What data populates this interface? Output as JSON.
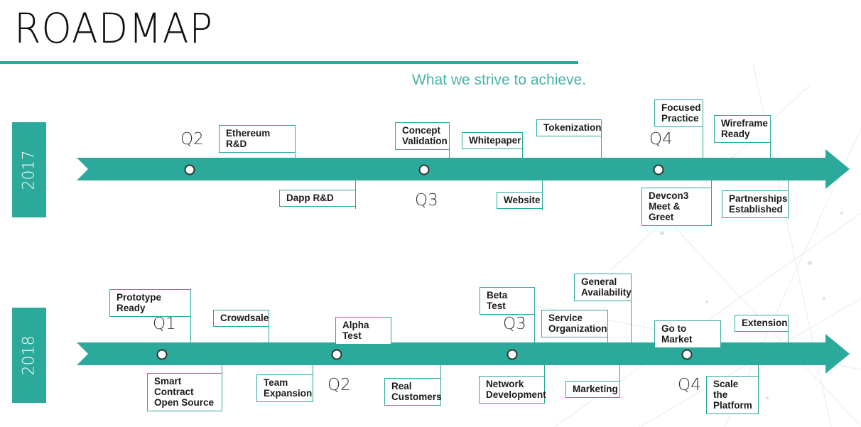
{
  "header": {
    "title": "ROADMAP",
    "subtitle": "What we strive to achieve."
  },
  "colors": {
    "accent": "#2ba99a",
    "subtitle": "#48b3a8",
    "text": "#1a1a1a"
  },
  "timelines": [
    {
      "year": "2017",
      "quarters": [
        "Q2",
        "Q3",
        "Q4"
      ],
      "milestones": {
        "ethereum_rd": "Ethereum R&D",
        "dapp_rd": "Dapp R&D",
        "concept_validation": "Concept\nValidation",
        "whitepaper": "Whitepaper",
        "website": "Website",
        "tokenization": "Tokenization",
        "focused_practice": "Focused\nPractice",
        "wireframe_ready": "Wireframe\nReady",
        "devcon3": "Devcon3\nMeet & Greet",
        "partnerships": "Partnerships\nEstablished"
      }
    },
    {
      "year": "2018",
      "quarters": [
        "Q1",
        "Q2",
        "Q3",
        "Q4"
      ],
      "milestones": {
        "prototype_ready": "Prototype Ready",
        "smart_contract": "Smart Contract\nOpen Source",
        "crowdsale": "Crowdsale",
        "team_expansion": "Team\nExpansion",
        "alpha_test": "Alpha Test",
        "real_customers": "Real\nCustomers",
        "beta_test": "Beta Test",
        "network_development": "Network\nDevelopment",
        "general_availability": "General\nAvailability",
        "service_organization": "Service\nOrganization",
        "marketing": "Marketing",
        "go_to_market": "Go to Market",
        "extension": "Extension",
        "scale_platform": "Scale the\nPlatform"
      }
    }
  ]
}
